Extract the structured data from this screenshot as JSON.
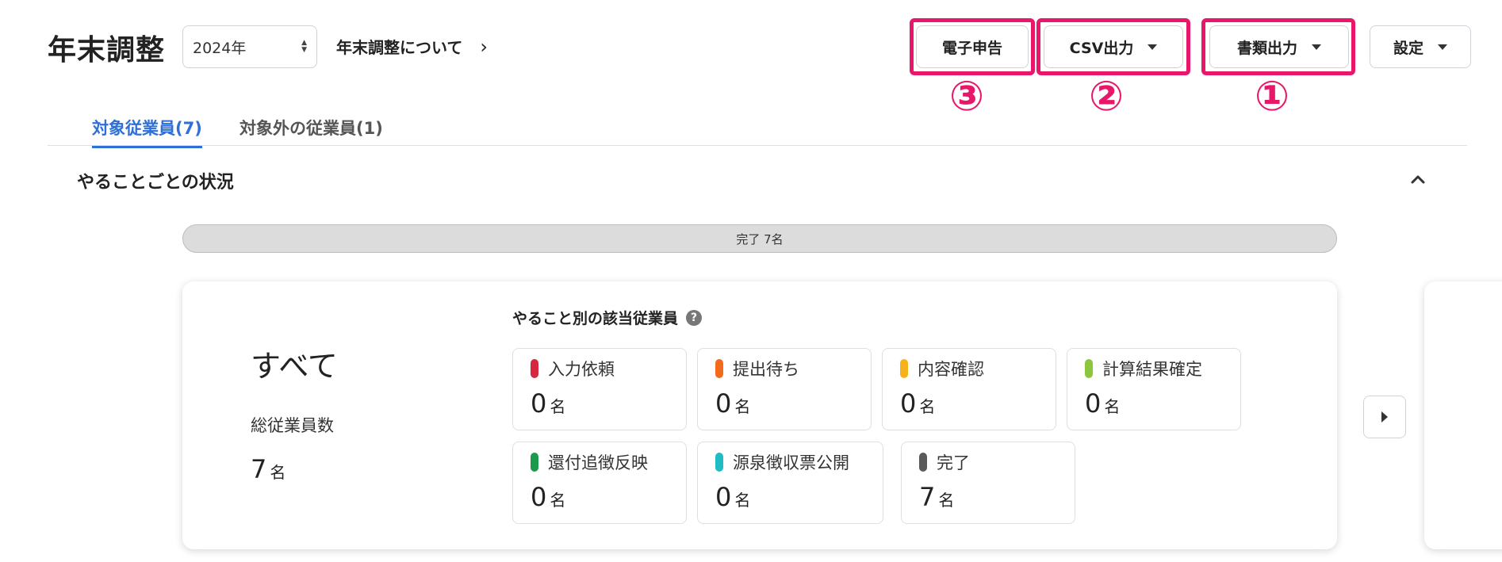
{
  "header": {
    "title": "年末調整",
    "year_select": "2024年",
    "about_link": "年末調整について",
    "buttons": {
      "e_filing": "電子申告",
      "csv_export": "CSV出力",
      "document_export": "書類出力",
      "settings": "設定"
    },
    "annotations": {
      "one": "①",
      "two": "②",
      "three": "③"
    },
    "highlight_color": "#e8176a"
  },
  "tabs": [
    {
      "label": "対象従業員(7)",
      "active": true
    },
    {
      "label": "対象外の従業員(1)",
      "active": false
    }
  ],
  "section": {
    "title": "やることごとの状況",
    "progress_label": "完了 7名",
    "progress_fraction": 1.0
  },
  "card": {
    "all_label": "すべて",
    "total_label": "総従業員数",
    "total_value": "7",
    "total_unit": "名",
    "tasks_heading": "やること別の該当従業員",
    "help_icon_glyph": "?",
    "statuses": [
      {
        "label": "入力依頼",
        "count": "0",
        "unit": "名",
        "color": "#d7263d"
      },
      {
        "label": "提出待ち",
        "count": "0",
        "unit": "名",
        "color": "#f26b1d"
      },
      {
        "label": "内容確認",
        "count": "0",
        "unit": "名",
        "color": "#f5b21b"
      },
      {
        "label": "計算結果確定",
        "count": "0",
        "unit": "名",
        "color": "#8cc63f"
      },
      {
        "label": "還付追徴反映",
        "count": "0",
        "unit": "名",
        "color": "#1a9a4b"
      },
      {
        "label": "源泉徴収票公開",
        "count": "0",
        "unit": "名",
        "color": "#1fbcc4"
      },
      {
        "label": "完了",
        "count": "7",
        "unit": "名",
        "color": "#5a5a5a"
      }
    ]
  }
}
